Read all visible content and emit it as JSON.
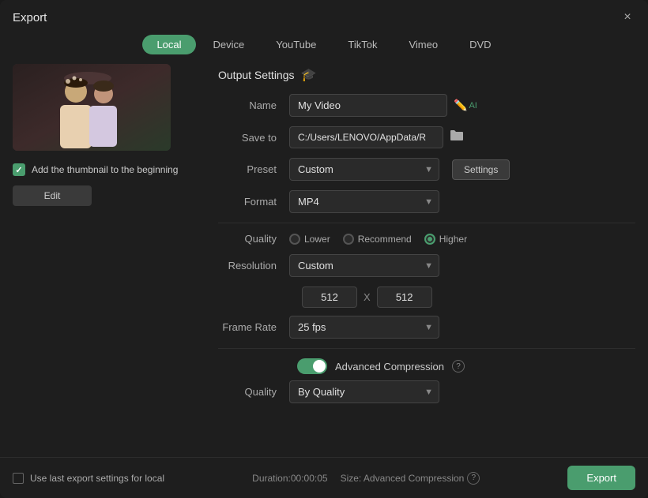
{
  "window": {
    "title": "Export",
    "close_label": "×"
  },
  "tabs": [
    {
      "label": "Local",
      "active": true
    },
    {
      "label": "Device",
      "active": false
    },
    {
      "label": "YouTube",
      "active": false
    },
    {
      "label": "TikTok",
      "active": false
    },
    {
      "label": "Vimeo",
      "active": false
    },
    {
      "label": "DVD",
      "active": false
    }
  ],
  "left_panel": {
    "thumbnail_alt": "Wedding video thumbnail",
    "add_thumbnail_label": "Add the thumbnail to the beginning",
    "edit_button_label": "Edit"
  },
  "output_settings": {
    "header_label": "Output Settings",
    "name_label": "Name",
    "name_value": "My Video",
    "save_to_label": "Save to",
    "save_to_value": "C:/Users/LENOVO/AppData/R",
    "preset_label": "Preset",
    "preset_value": "Custom",
    "settings_button_label": "Settings",
    "format_label": "Format",
    "format_value": "MP4",
    "quality_label": "Quality",
    "quality_options": [
      {
        "label": "Lower",
        "checked": false
      },
      {
        "label": "Recommend",
        "checked": false
      },
      {
        "label": "Higher",
        "checked": true
      }
    ],
    "resolution_label": "Resolution",
    "resolution_value": "Custom",
    "resolution_width": "512",
    "resolution_x": "X",
    "resolution_height": "512",
    "frame_rate_label": "Frame Rate",
    "frame_rate_value": "25 fps",
    "advanced_compression_label": "Advanced Compression",
    "by_quality_value": "By Quality",
    "quality_label2": "Quality"
  },
  "footer": {
    "use_last_settings_label": "Use last export settings for local",
    "duration_label": "Duration:",
    "duration_value": "00:00:05",
    "size_label": "Size: Advanced Compression",
    "export_button_label": "Export"
  },
  "colors": {
    "accent": "#4a9d6e",
    "bg_dark": "#1e1e1e",
    "bg_input": "#2a2a2a"
  }
}
